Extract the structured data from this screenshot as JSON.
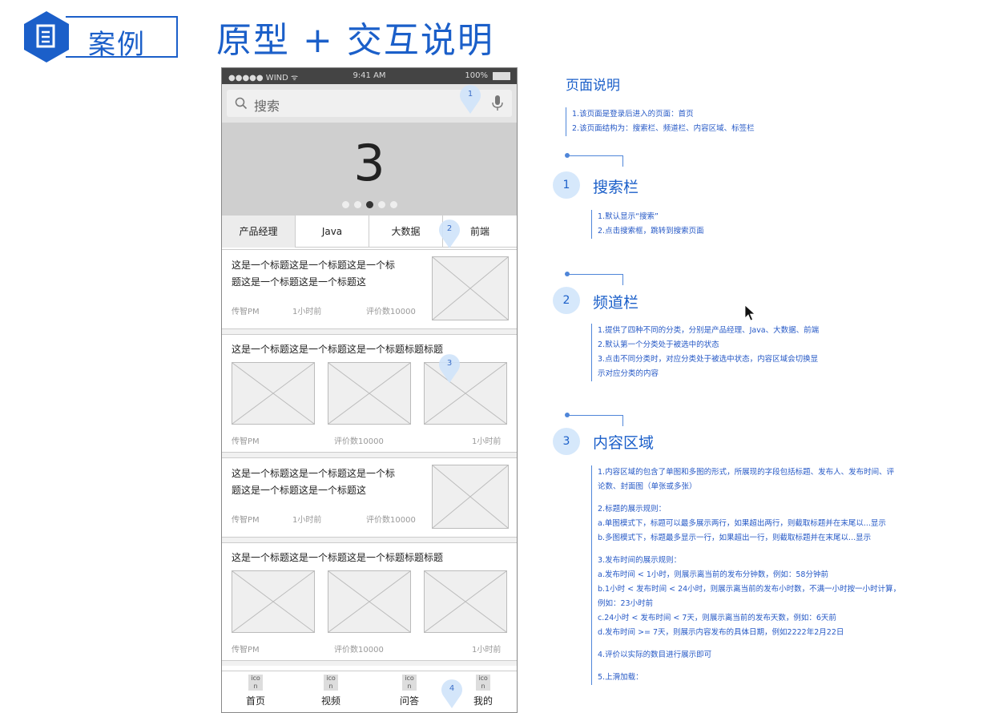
{
  "header": {
    "badge_label": "案例",
    "title": "原型 + 交互说明"
  },
  "phone": {
    "status_bar": {
      "carrier": "●●●●● WIND ᯤ",
      "time": "9:41 AM",
      "battery": "100%"
    },
    "search": {
      "placeholder": "搜索"
    },
    "banner": {
      "number": "3",
      "dot_count": 5,
      "active_dot": 2
    },
    "tabs": [
      {
        "label": "产品经理",
        "selected": true
      },
      {
        "label": "Java",
        "selected": false
      },
      {
        "label": "大数据",
        "selected": false
      },
      {
        "label": "前端",
        "selected": false
      }
    ],
    "cards": [
      {
        "type": "single",
        "title_line1": "这是一个标题这是一个标题这是一个标",
        "title_line2": "题这是一个标题这是一个标题这",
        "author": "传智PM",
        "time": "1小时前",
        "reviews": "评价数10000"
      },
      {
        "type": "multi",
        "title": "这是一个标题这是一个标题这是一个标题标题标题",
        "author": "传智PM",
        "reviews": "评价数10000",
        "time": "1小时前"
      },
      {
        "type": "single",
        "title_line1": "这是一个标题这是一个标题这是一个标",
        "title_line2": "题这是一个标题这是一个标题这",
        "author": "传智PM",
        "time": "1小时前",
        "reviews": "评价数10000"
      },
      {
        "type": "multi",
        "title": "这是一个标题这是一个标题这是一个标题标题标题",
        "author": "传智PM",
        "reviews": "评价数10000",
        "time": "1小时前"
      }
    ],
    "bottom_nav": [
      {
        "icon_text": "ico n",
        "label": "首页"
      },
      {
        "icon_text": "ico n",
        "label": "视频"
      },
      {
        "icon_text": "ico n",
        "label": "问答"
      },
      {
        "icon_text": "ico n",
        "label": "我的"
      }
    ],
    "markers": [
      "1",
      "2",
      "3",
      "4"
    ]
  },
  "annotations": {
    "page_title": "页面说明",
    "page_notes": [
      "1.该页面是登录后进入的页面：首页",
      "2.该页面结构为：搜索栏、频道栏、内容区域、标签栏"
    ],
    "sections": [
      {
        "num": "1",
        "heading": "搜索栏",
        "notes": [
          "1.默认显示“搜索”",
          "2.点击搜索框，跳转到搜索页面"
        ]
      },
      {
        "num": "2",
        "heading": "频道栏",
        "notes": [
          "1.提供了四种不同的分类，分别是产品经理、Java、大数据、前端",
          "2.默认第一个分类处于被选中的状态",
          "3.点击不同分类时，对应分类处于被选中状态，内容区域会切换显",
          "示对应分类的内容"
        ]
      },
      {
        "num": "3",
        "heading": "内容区域",
        "notes": [
          "1.内容区域的包含了单图和多图的形式，所展现的字段包括标题、发布人、发布时间、评",
          "论数、封面图（单张或多张）",
          "",
          "2.标题的展示规则：",
          "a.单图模式下，标题可以最多展示两行，如果超出两行，则截取标题并在末尾以...显示",
          "b.多图模式下，标题最多显示一行，如果超出一行，则截取标题并在末尾以...显示",
          "",
          "3.发布时间的展示规则：",
          "a.发布时间 < 1小时，则展示离当前的发布分钟数，例如：58分钟前",
          "b.1小时 < 发布时间 < 24小时，则展示离当前的发布小时数，不满一小时按一小时计算，",
          "例如：23小时前",
          "c.24小时 < 发布时间 < 7天，则展示离当前的发布天数，例如：6天前",
          "d.发布时间 >= 7天，则展示内容发布的具体日期，例如2222年2月22日",
          "",
          "4.评价以实际的数目进行展示即可",
          "",
          "5.上滑加载："
        ]
      }
    ]
  },
  "colors": {
    "brand_blue": "#1b5fc9",
    "annotation_blue": "#2659c6",
    "marker_fill": "#d6e8fb"
  }
}
